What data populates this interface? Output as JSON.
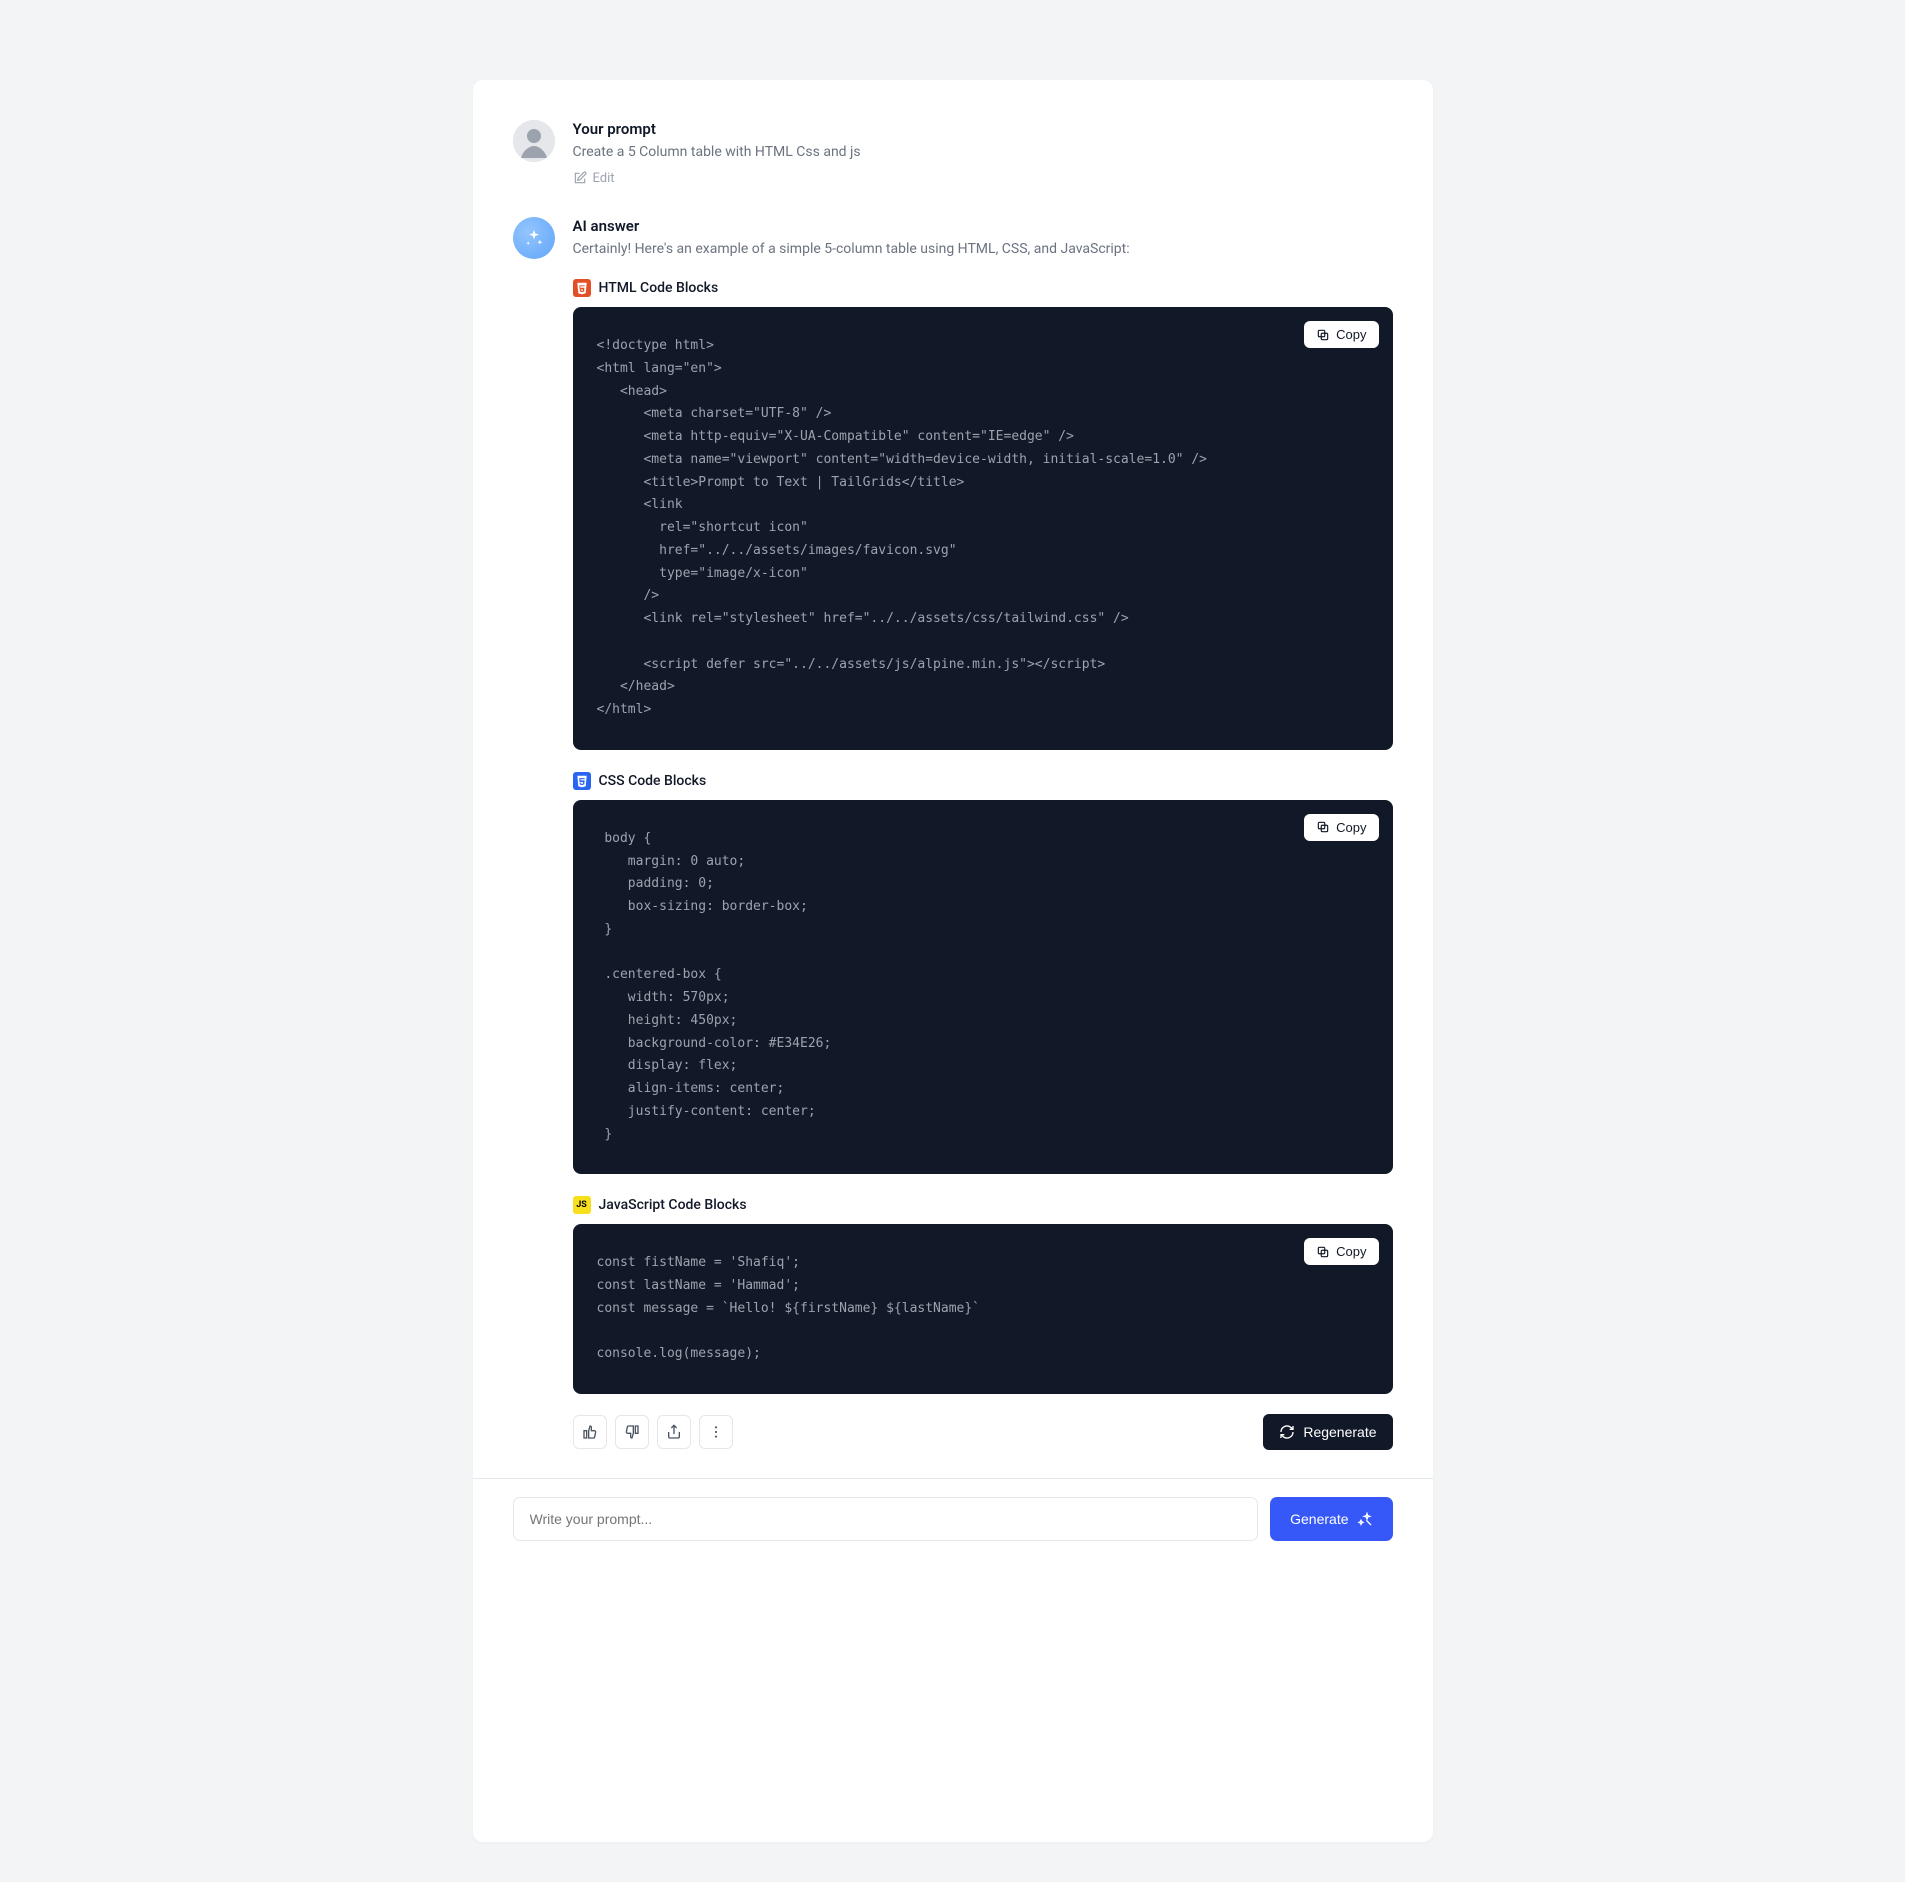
{
  "prompt": {
    "heading": "Your prompt",
    "text": "Create a 5 Column table with HTML Css and js",
    "edit_label": "Edit"
  },
  "answer": {
    "heading": "AI answer",
    "intro": "Certainly! Here's an example of a simple 5-column table using HTML, CSS, and JavaScript:",
    "blocks": {
      "html": {
        "label": "HTML Code Blocks",
        "copy_label": "Copy",
        "code": "<!doctype html>\n<html lang=\"en\">\n   <head>\n      <meta charset=\"UTF-8\" />\n      <meta http-equiv=\"X-UA-Compatible\" content=\"IE=edge\" />\n      <meta name=\"viewport\" content=\"width=device-width, initial-scale=1.0\" />\n      <title>Prompt to Text | TailGrids</title>\n      <link\n        rel=\"shortcut icon\"\n        href=\"../../assets/images/favicon.svg\"\n        type=\"image/x-icon\"\n      />\n      <link rel=\"stylesheet\" href=\"../../assets/css/tailwind.css\" />\n\n      <script defer src=\"../../assets/js/alpine.min.js\"></script>\n   </head>\n</html>"
      },
      "css": {
        "label": "CSS Code Blocks",
        "copy_label": "Copy",
        "code": " body {\n    margin: 0 auto;\n    padding: 0;\n    box-sizing: border-box;\n }\n\n .centered-box {\n    width: 570px;\n    height: 450px;\n    background-color: #E34E26;\n    display: flex;\n    align-items: center;\n    justify-content: center;\n }"
      },
      "js": {
        "label": "JavaScript Code Blocks",
        "copy_label": "Copy",
        "code": "const fistName = 'Shafiq';\nconst lastName = 'Hammad';\nconst message = `Hello! ${firstName} ${lastName}`\n\nconsole.log(message);"
      }
    },
    "regenerate_label": "Regenerate"
  },
  "input": {
    "placeholder": "Write your prompt...",
    "generate_label": "Generate"
  }
}
